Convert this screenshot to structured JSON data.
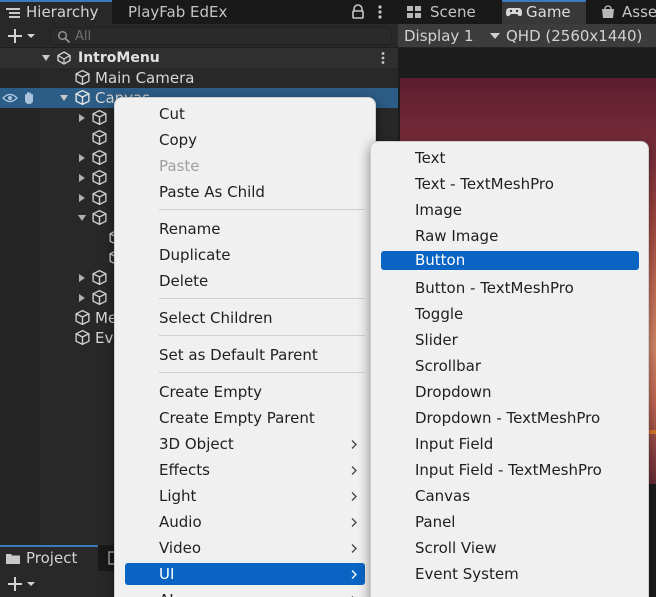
{
  "hierarchy": {
    "tab_label": "Hierarchy",
    "other_tab_label": "PlayFab EdEx",
    "search_placeholder": "All",
    "scene_name": "IntroMenu",
    "objects": [
      {
        "label": "Main Camera"
      },
      {
        "label": "Canvas"
      },
      {
        "label": "Me"
      },
      {
        "label": "Ev"
      }
    ]
  },
  "project": {
    "tab_label": "Project"
  },
  "game": {
    "scene_tab": "Scene",
    "game_tab": "Game",
    "assets_tab": "Asse",
    "display": "Display 1",
    "resolution": "QHD (2560x1440)"
  },
  "context_menu": {
    "items": [
      {
        "label": "Cut"
      },
      {
        "label": "Copy"
      },
      {
        "label": "Paste",
        "disabled": true
      },
      {
        "label": "Paste As Child"
      },
      {
        "label": "Rename"
      },
      {
        "label": "Duplicate"
      },
      {
        "label": "Delete"
      },
      {
        "label": "Select Children"
      },
      {
        "label": "Set as Default Parent"
      },
      {
        "label": "Create Empty"
      },
      {
        "label": "Create Empty Parent"
      },
      {
        "label": "3D Object",
        "submenu": true
      },
      {
        "label": "Effects",
        "submenu": true
      },
      {
        "label": "Light",
        "submenu": true
      },
      {
        "label": "Audio",
        "submenu": true
      },
      {
        "label": "Video",
        "submenu": true
      },
      {
        "label": "UI",
        "submenu": true,
        "active": true
      },
      {
        "label": "AI",
        "submenu": true
      }
    ]
  },
  "ui_submenu": {
    "items": [
      {
        "label": "Text"
      },
      {
        "label": "Text - TextMeshPro"
      },
      {
        "label": "Image"
      },
      {
        "label": "Raw Image"
      },
      {
        "label": "Button",
        "active": true
      },
      {
        "label": "Button - TextMeshPro"
      },
      {
        "label": "Toggle"
      },
      {
        "label": "Slider"
      },
      {
        "label": "Scrollbar"
      },
      {
        "label": "Dropdown"
      },
      {
        "label": "Dropdown - TextMeshPro"
      },
      {
        "label": "Input Field"
      },
      {
        "label": "Input Field - TextMeshPro"
      },
      {
        "label": "Canvas"
      },
      {
        "label": "Panel"
      },
      {
        "label": "Scroll View"
      },
      {
        "label": "Event System"
      }
    ]
  },
  "colors": {
    "selection": "#2c5d87",
    "menu_highlight": "#0a64c4",
    "tab_accent": "#3a79bb"
  }
}
